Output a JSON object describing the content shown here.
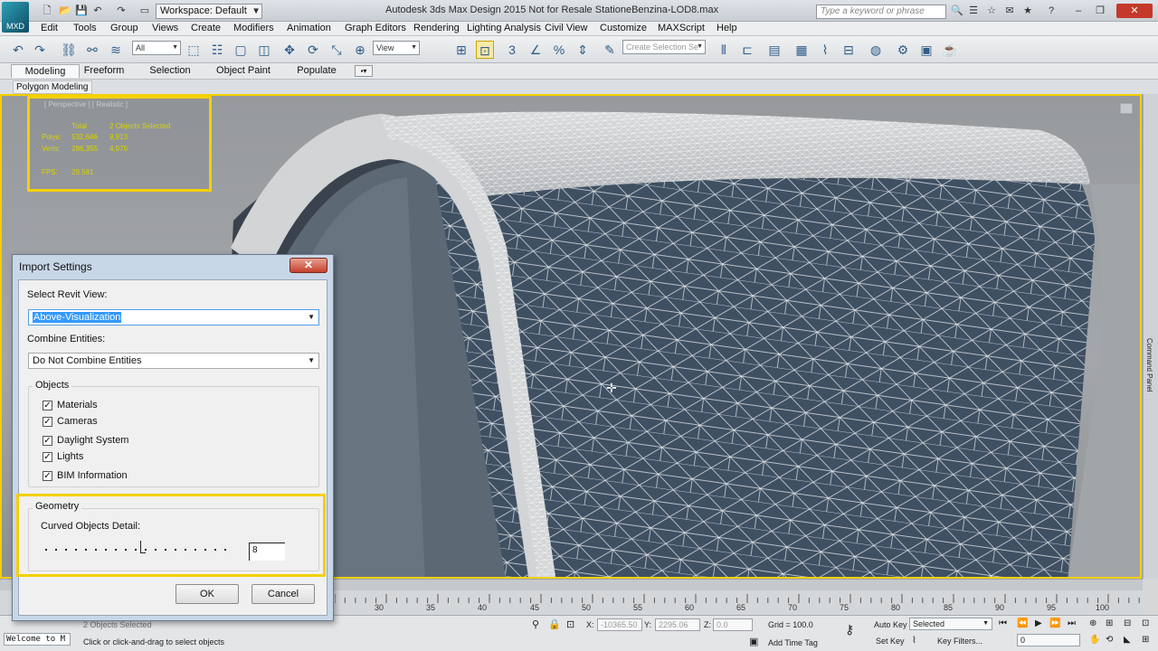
{
  "app": {
    "title": "Autodesk 3ds Max Design 2015    Not for Resale    StationeBenzina-LOD8.max",
    "logo": "MXD",
    "workspace": "Workspace: Default",
    "search_placeholder": "Type a keyword or phrase"
  },
  "menu": [
    "Edit",
    "Tools",
    "Group",
    "Views",
    "Create",
    "Modifiers",
    "Animation",
    "Graph Editors",
    "Rendering",
    "Lighting Analysis",
    "Civil View",
    "Customize",
    "MAXScript",
    "Help"
  ],
  "toolbar": {
    "selection_filter": "All",
    "ref_coord": "View",
    "named_selection_placeholder": "Create Selection Se"
  },
  "ribbon": {
    "tabs": [
      "Modeling",
      "Freeform",
      "Selection",
      "Object Paint",
      "Populate"
    ],
    "active_tab": "Modeling",
    "sub_label": "Polygon Modeling"
  },
  "viewport": {
    "label": "[ Perspective ] [ Realistic ]",
    "stats": {
      "header_total": "Total",
      "header_selected": "2 Objects Selected",
      "polys_label": "Polys:",
      "polys_total": "532,646",
      "polys_selected": "9,913",
      "verts_label": "Verts:",
      "verts_total": "286,355",
      "verts_selected": "4,976",
      "fps_label": "FPS:",
      "fps_value": "29.581"
    }
  },
  "command_panel": {
    "label": "Command Panel"
  },
  "dialog": {
    "title": "Import Settings",
    "close": "✕",
    "select_view_label": "Select Revit View:",
    "select_view_value": "Above-Visualization",
    "combine_label": "Combine Entities:",
    "combine_value": "Do Not Combine Entities",
    "objects_group": "Objects",
    "objects": [
      {
        "label": "Materials",
        "checked": true
      },
      {
        "label": "Cameras",
        "checked": true
      },
      {
        "label": "Daylight System",
        "checked": true
      },
      {
        "label": "Lights",
        "checked": true
      },
      {
        "label": "BIM Information",
        "checked": true
      }
    ],
    "geometry_group": "Geometry",
    "curved_label": "Curved Objects Detail:",
    "curved_value": "8",
    "ok": "OK",
    "cancel": "Cancel"
  },
  "timeline": {
    "ticks": [
      "30",
      "35",
      "40",
      "45",
      "50",
      "55",
      "60",
      "65",
      "70",
      "75",
      "80",
      "85",
      "90",
      "95",
      "100"
    ]
  },
  "status": {
    "selected_count": "2 Objects Selected",
    "prompt": "Click or click-and-drag to select objects",
    "maxscript": "Welcome to M",
    "x_label": "X:",
    "x_value": "-10365.50",
    "y_label": "Y:",
    "y_value": "2295.06",
    "z_label": "Z:",
    "z_value": "0.0",
    "grid": "Grid = 100.0",
    "add_time_tag": "Add Time Tag",
    "auto_key": "Auto Key",
    "set_key": "Set Key",
    "key_mode": "Selected",
    "key_filters": "Key Filters...",
    "frame": "0"
  }
}
